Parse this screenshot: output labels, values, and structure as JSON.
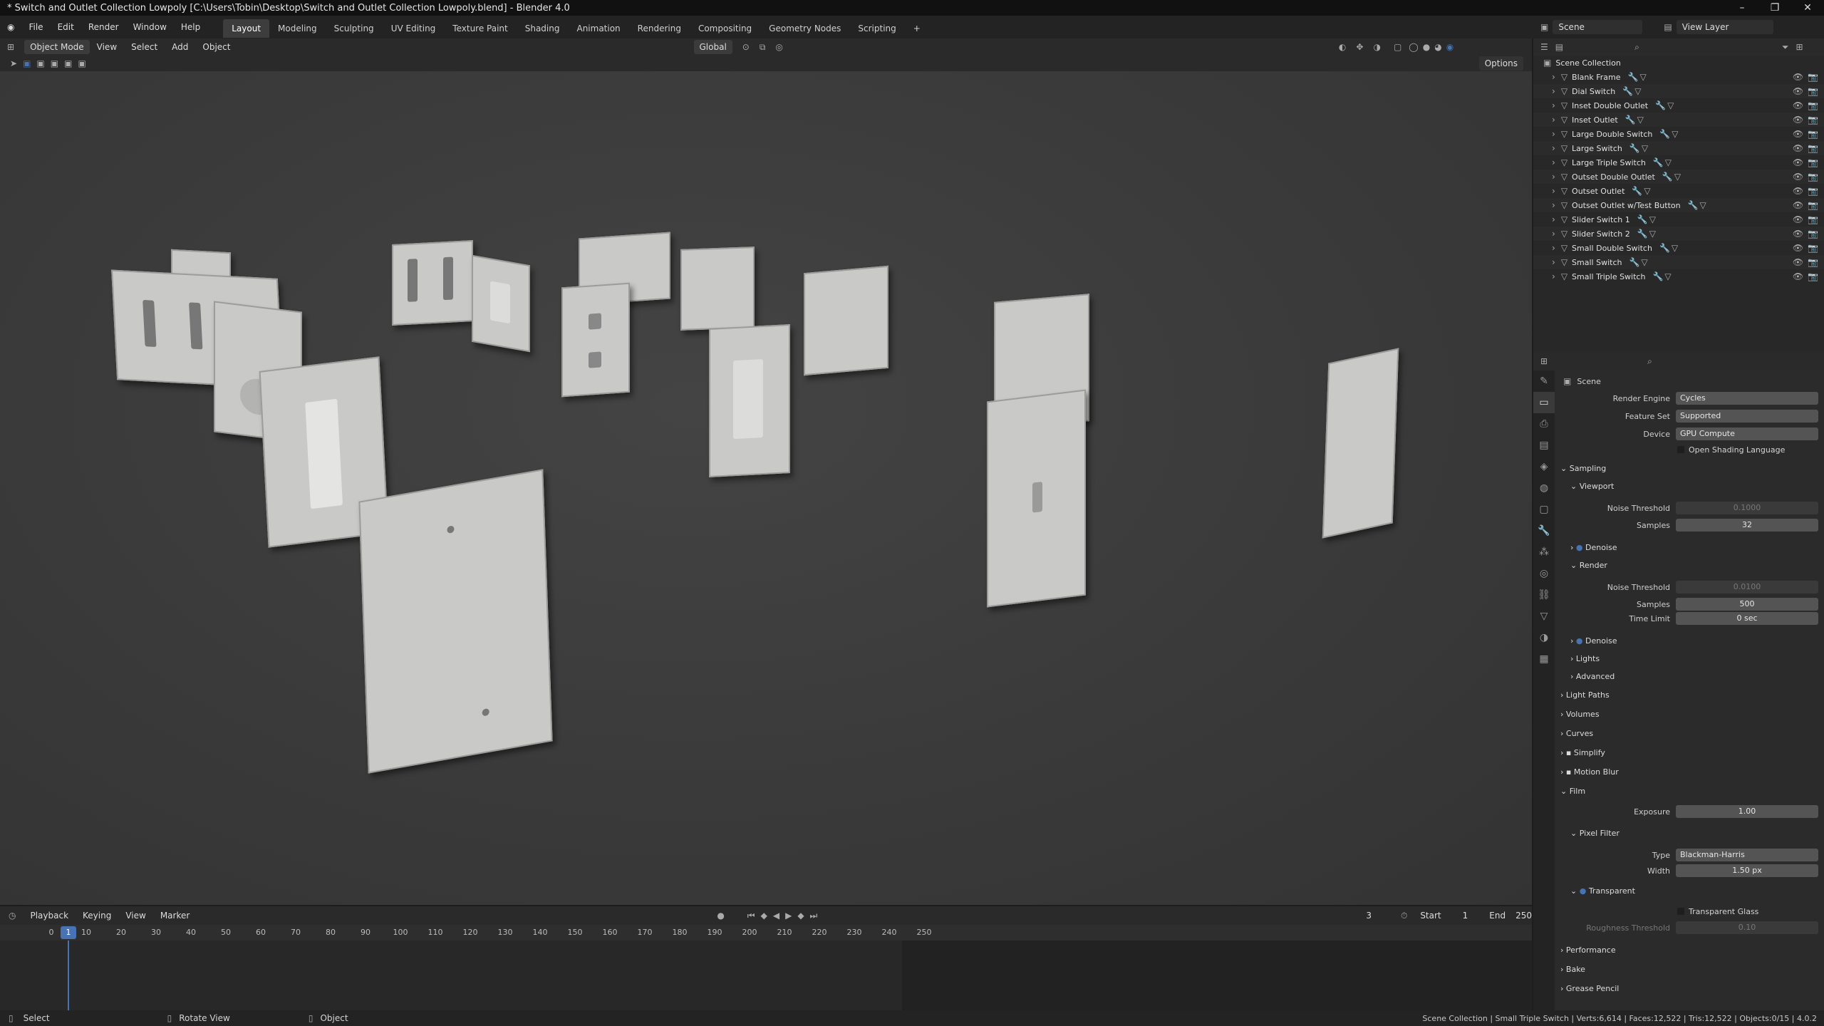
{
  "window": {
    "title": "* Switch and Outlet Collection Lowpoly [C:\\Users\\Tobin\\Desktop\\Switch and Outlet Collection Lowpoly.blend] - Blender 4.0",
    "controls": [
      "–",
      "❐",
      "✕"
    ]
  },
  "menu": [
    "File",
    "Edit",
    "Render",
    "Window",
    "Help"
  ],
  "workspaces": [
    "Layout",
    "Modeling",
    "Sculpting",
    "UV Editing",
    "Texture Paint",
    "Shading",
    "Animation",
    "Rendering",
    "Compositing",
    "Geometry Nodes",
    "Scripting"
  ],
  "active_workspace": "Layout",
  "scene_selector": "Scene",
  "view_layer": "View Layer",
  "viewport_header": {
    "mode": "Object Mode",
    "menus": [
      "View",
      "Select",
      "Add",
      "Object"
    ],
    "orientation": "Global",
    "options_label": "Options"
  },
  "timeline": {
    "menus": [
      "Playback",
      "Keying",
      "View",
      "Marker"
    ],
    "current_frame": "3",
    "start_label": "Start",
    "start": "1",
    "end_label": "End",
    "end": "250",
    "playhead": "1",
    "ticks": [
      "0",
      "10",
      "20",
      "30",
      "40",
      "50",
      "60",
      "70",
      "80",
      "90",
      "100",
      "110",
      "120",
      "130",
      "140",
      "150",
      "160",
      "170",
      "180",
      "190",
      "200",
      "210",
      "220",
      "230",
      "240",
      "250"
    ]
  },
  "statusbar": {
    "select": "Select",
    "rotate": "Rotate View",
    "object": "Object",
    "info": "Scene Collection | Small Triple Switch | Verts:6,614 | Faces:12,522 | Tris:12,522 | Objects:0/15 | 4.0.2"
  },
  "outliner": {
    "root": "Scene Collection",
    "items": [
      "Blank Frame",
      "Dial Switch",
      "Inset Double Outlet",
      "Inset Outlet",
      "Large Double Switch",
      "Large Switch",
      "Large Triple Switch",
      "Outset Double Outlet",
      "Outset Outlet",
      "Outset Outlet w/Test Button",
      "Slider Switch 1",
      "Slider Switch 2",
      "Small Double Switch",
      "Small Switch",
      "Small Triple Switch"
    ]
  },
  "properties": {
    "context": "Scene",
    "render_engine_label": "Render Engine",
    "render_engine": "Cycles",
    "feature_set_label": "Feature Set",
    "feature_set": "Supported",
    "device_label": "Device",
    "device": "GPU Compute",
    "osl": "Open Shading Language",
    "sampling": "Sampling",
    "viewport": "Viewport",
    "noise_threshold_label": "Noise Threshold",
    "viewport_noise": "0.1000",
    "samples_label": "Samples",
    "viewport_samples": "32",
    "denoise": "Denoise",
    "render": "Render",
    "render_noise": "0.0100",
    "render_samples": "500",
    "time_limit_label": "Time Limit",
    "time_limit": "0 sec",
    "lights": "Lights",
    "advanced": "Advanced",
    "light_paths": "Light Paths",
    "volumes": "Volumes",
    "curves": "Curves",
    "simplify": "Simplify",
    "motion_blur": "Motion Blur",
    "film": "Film",
    "exposure_label": "Exposure",
    "exposure": "1.00",
    "pixel_filter": "Pixel Filter",
    "type_label": "Type",
    "filter_type": "Blackman-Harris",
    "width_label": "Width",
    "filter_width": "1.50 px",
    "transparent": "Transparent",
    "transparent_glass": "Transparent Glass",
    "roughness_label": "Roughness Threshold",
    "roughness": "0.10",
    "performance": "Performance",
    "bake": "Bake",
    "grease_pencil": "Grease Pencil"
  },
  "colors": {
    "accent": "#4772b3",
    "selected_frame": "#4772b3"
  }
}
